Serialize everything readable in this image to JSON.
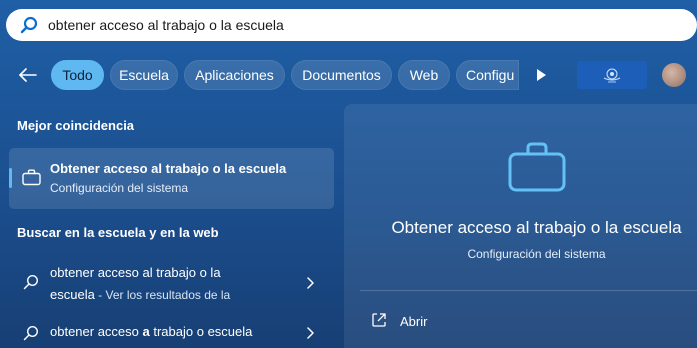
{
  "search": {
    "query": "obtener acceso al trabajo o la escuela"
  },
  "filters": {
    "tabs": [
      {
        "label": "Todo",
        "active": true
      },
      {
        "label": "Escuela",
        "active": false
      },
      {
        "label": "Aplicaciones",
        "active": false
      },
      {
        "label": "Documentos",
        "active": false
      },
      {
        "label": "Web",
        "active": false
      },
      {
        "label": "Configu",
        "active": false
      }
    ]
  },
  "best_match": {
    "section_label": "Mejor coincidencia",
    "title": "Obtener acceso al trabajo o la escuela",
    "subtitle": "Configuración del sistema",
    "icon": "briefcase-icon"
  },
  "web_search": {
    "section_label": "Buscar en la escuela y en la web",
    "items": [
      {
        "line1": "obtener acceso al trabajo o la",
        "line2_main": "escuela",
        "line2_note": " - Ver los resultados de la"
      },
      {
        "line1_prefix": "obtener acceso ",
        "line1_bold": "a",
        "line1_suffix": " trabajo o escuela"
      }
    ]
  },
  "detail": {
    "title": "Obtener acceso al trabajo o la escuela",
    "subtitle": "Configuración del sistema",
    "action_label": "Abrir"
  },
  "colors": {
    "accent": "#5fb8f0",
    "background": "#1f5fa6"
  }
}
